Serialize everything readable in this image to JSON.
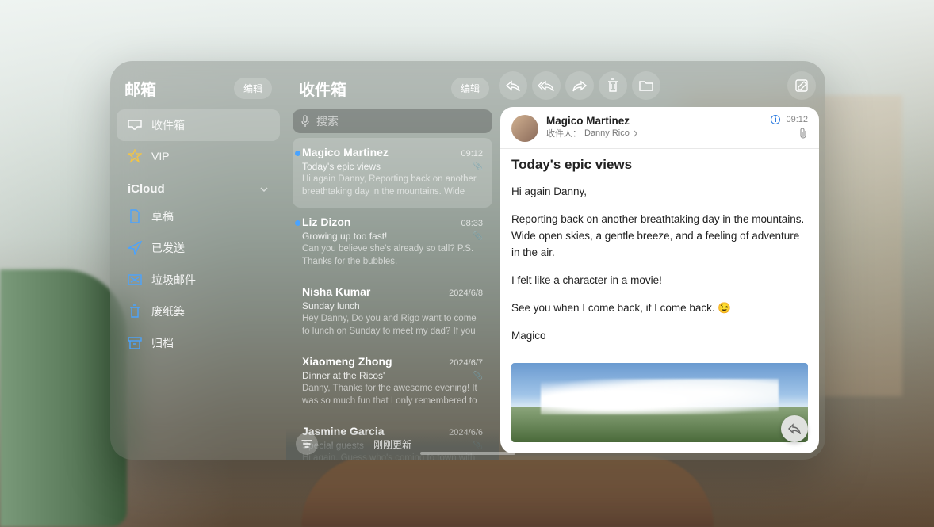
{
  "sidebar": {
    "title": "邮箱",
    "edit": "编辑",
    "inbox": "收件箱",
    "vip": "VIP",
    "section": "iCloud",
    "folders": {
      "drafts": "草稿",
      "sent": "已发送",
      "junk": "垃圾邮件",
      "trash": "废纸篓",
      "archive": "归档"
    }
  },
  "list": {
    "title": "收件箱",
    "edit": "编辑",
    "search_placeholder": "搜索",
    "status": "刚刚更新",
    "messages": [
      {
        "sender": "Magico Martinez",
        "time": "09:12",
        "subject": "Today's epic views",
        "preview": "Hi again Danny, Reporting back on another breathtaking day in the mountains. Wide open…",
        "attachment": true,
        "unread": true
      },
      {
        "sender": "Liz Dizon",
        "time": "08:33",
        "subject": "Growing up too fast!",
        "preview": "Can you believe she's already so tall? P.S. Thanks for the bubbles.",
        "attachment": true,
        "unread": true
      },
      {
        "sender": "Nisha Kumar",
        "time": "2024/6/8",
        "subject": "Sunday lunch",
        "preview": "Hey Danny, Do you and Rigo want to come to lunch on Sunday to meet my dad? If you two j…",
        "attachment": false,
        "unread": false
      },
      {
        "sender": "Xiaomeng Zhong",
        "time": "2024/6/7",
        "subject": "Dinner at the Ricos'",
        "preview": "Danny, Thanks for the awesome evening! It was so much fun that I only remembered to take o…",
        "attachment": true,
        "unread": false
      },
      {
        "sender": "Jasmine Garcia",
        "time": "2024/6/6",
        "subject": "Special guests",
        "preview": "Hi again, Guess who's coming to town with me",
        "attachment": true,
        "unread": false
      }
    ]
  },
  "reader": {
    "sender": "Magico Martinez",
    "to_label": "收件人：",
    "to_name": "Danny Rico",
    "time": "09:12",
    "subject": "Today's epic views",
    "p1": "Hi again Danny,",
    "p2": "Reporting back on another breathtaking day in the mountains. Wide open skies, a gentle breeze, and a feeling of adventure in the air.",
    "p3": "I felt like a character in a movie!",
    "p4": "See you when I come back, if I come back. 😉",
    "p5": "Magico"
  }
}
